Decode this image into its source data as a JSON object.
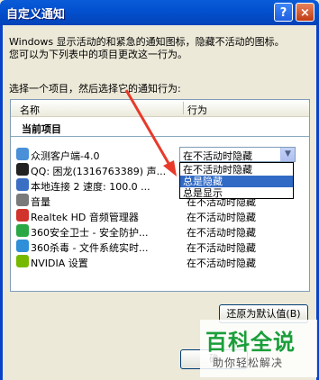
{
  "window": {
    "title": "自定义通知",
    "help_label": "?",
    "close_label": "×"
  },
  "description": {
    "line1": "Windows 显示活动的和紧急的通知图标，隐藏不活动的图标。",
    "line2": "您可以为下列表中的项目更改这一行为。"
  },
  "prompt": "选择一个项目，然后选择它的通知行为:",
  "table": {
    "col_name": "名称",
    "col_behavior": "行为",
    "group_label": "当前项目",
    "rows": [
      {
        "name": "众测客户端-4.0",
        "behavior": "在不活动时隐藏",
        "icon": "cloud-icon",
        "color": "#4a90d9"
      },
      {
        "name": "QQ: 困龙(1316763389) 声...",
        "behavior": "",
        "icon": "qq-penguin-icon",
        "color": "#222222"
      },
      {
        "name": "本地连接 2 速度: 100.0 ...",
        "behavior": "",
        "icon": "network-icon",
        "color": "#3a6fc4"
      },
      {
        "name": "音量",
        "behavior": "在不活动时隐藏",
        "icon": "speaker-icon",
        "color": "#7a7a7a"
      },
      {
        "name": "Realtek HD 音频管理器",
        "behavior": "在不活动时隐藏",
        "icon": "realtek-icon",
        "color": "#d0342c"
      },
      {
        "name": "360安全卫士 - 安全防护...",
        "behavior": "在不活动时隐藏",
        "icon": "360-shield-icon",
        "color": "#2aa845"
      },
      {
        "name": "360杀毒 - 文件系统实时...",
        "behavior": "在不活动时隐藏",
        "icon": "360-antivirus-icon",
        "color": "#2f8fd8"
      },
      {
        "name": "NVIDIA 设置",
        "behavior": "在不活动时隐藏",
        "icon": "nvidia-icon",
        "color": "#76b900"
      }
    ]
  },
  "combo": {
    "value": "在不活动时隐藏",
    "arrow": "▼"
  },
  "dropdown": {
    "options": [
      "在不活动时隐藏",
      "总是隐藏",
      "总是显示"
    ],
    "selected_index": 1
  },
  "buttons": {
    "restore": "还原为默认值(B)",
    "ok": "确"
  },
  "watermark": {
    "main": "百科全说",
    "sub": "助你轻松解决"
  },
  "colors": {
    "titlebar": "#0351d0",
    "selection": "#316ac5",
    "arrow": "#e83a2a"
  }
}
